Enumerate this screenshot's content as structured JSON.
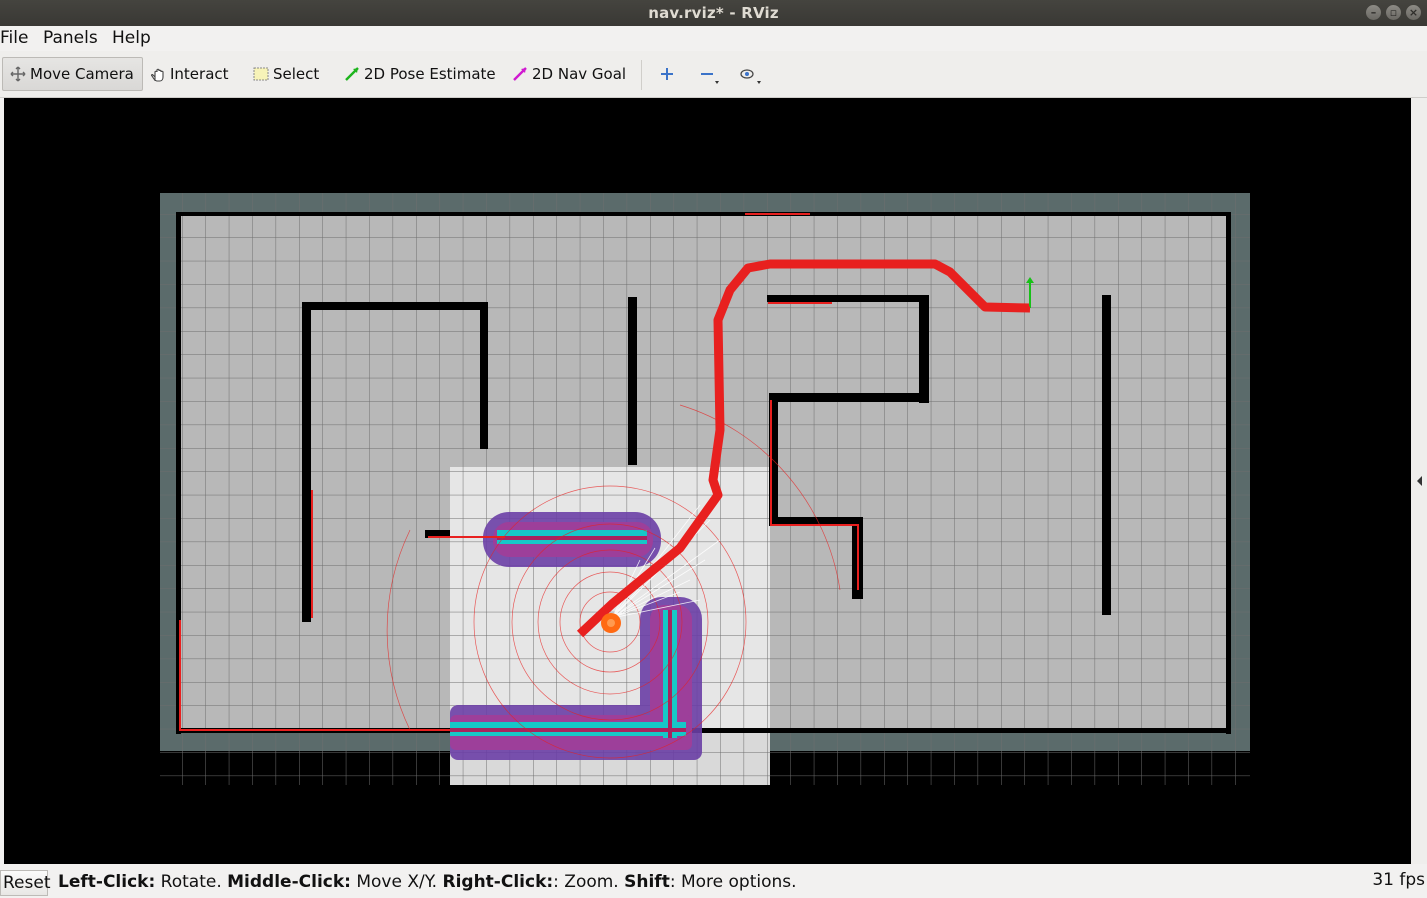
{
  "window": {
    "title": "nav.rviz* - RViz"
  },
  "menu": {
    "file": "File",
    "panels": "Panels",
    "help": "Help"
  },
  "toolbar": {
    "move_camera": "Move Camera",
    "interact": "Interact",
    "select": "Select",
    "pose_estimate": "2D Pose Estimate",
    "nav_goal": "2D Nav Goal"
  },
  "status": {
    "reset_label": "Reset",
    "left_click_key": "Left-Click:",
    "left_click_desc": " Rotate. ",
    "middle_click_key": "Middle-Click:",
    "middle_click_desc": " Move X/Y. ",
    "right_click_key": "Right-Click:",
    "right_click_desc": ": Zoom. ",
    "shift_key": "Shift",
    "shift_desc": ": More options.",
    "fps": "31 fps"
  },
  "colors": {
    "path": "#e8201f",
    "costmap_purple": "#7a3fa8",
    "costmap_cyan": "#16c8c8",
    "robot": "#ff6a13",
    "goal_arrow": "#18c018",
    "map_free": "#b8b8b8",
    "map_border": "#5b6b6b"
  }
}
